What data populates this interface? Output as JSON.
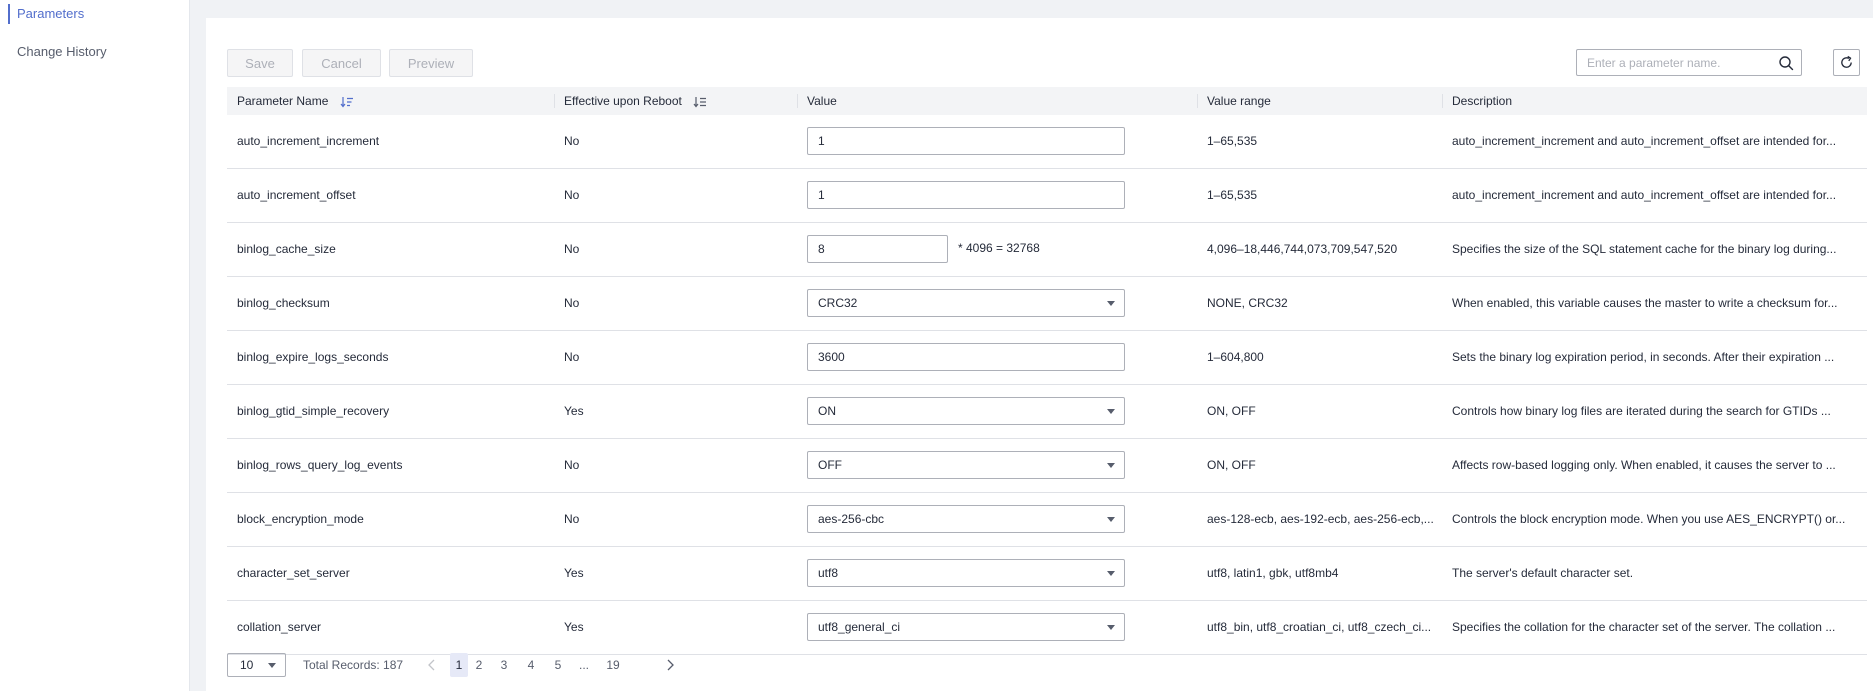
{
  "sidebar": {
    "items": [
      {
        "label": "Parameters",
        "active": true
      },
      {
        "label": "Change History",
        "active": false
      }
    ]
  },
  "toolbar": {
    "save_label": "Save",
    "cancel_label": "Cancel",
    "preview_label": "Preview",
    "search_placeholder": "Enter a parameter name.",
    "search_icon": "search-icon",
    "refresh_icon": "refresh-icon"
  },
  "table": {
    "columns": {
      "name": "Parameter Name",
      "reboot": "Effective upon Reboot",
      "value": "Value",
      "range": "Value range",
      "description": "Description"
    },
    "rows": [
      {
        "name": "auto_increment_increment",
        "reboot": "No",
        "value": "1",
        "control": "input",
        "range": "1–65,535",
        "description": "auto_increment_increment and auto_increment_offset are intended for..."
      },
      {
        "name": "auto_increment_offset",
        "reboot": "No",
        "value": "1",
        "control": "input",
        "range": "1–65,535",
        "description": "auto_increment_increment and auto_increment_offset are intended for..."
      },
      {
        "name": "binlog_cache_size",
        "reboot": "No",
        "value": "8",
        "control": "multiplier",
        "formula": "* 4096 = 32768",
        "range": "4,096–18,446,744,073,709,547,520",
        "description": "Specifies the size of the SQL statement cache for the binary log during..."
      },
      {
        "name": "binlog_checksum",
        "reboot": "No",
        "value": "CRC32",
        "control": "select",
        "range": "NONE, CRC32",
        "description": "When enabled, this variable causes the master to write a checksum for..."
      },
      {
        "name": "binlog_expire_logs_seconds",
        "reboot": "No",
        "value": "3600",
        "control": "input",
        "range": "1–604,800",
        "description": "Sets the binary log expiration period, in seconds. After their expiration ..."
      },
      {
        "name": "binlog_gtid_simple_recovery",
        "reboot": "Yes",
        "value": "ON",
        "control": "select",
        "range": "ON, OFF",
        "description": "Controls how binary log files are iterated during the search for GTIDs ..."
      },
      {
        "name": "binlog_rows_query_log_events",
        "reboot": "No",
        "value": "OFF",
        "control": "select",
        "range": "ON, OFF",
        "description": "Affects row-based logging only. When enabled, it causes the server to ..."
      },
      {
        "name": "block_encryption_mode",
        "reboot": "No",
        "value": "aes-256-cbc",
        "control": "select",
        "range": "aes-128-ecb, aes-192-ecb, aes-256-ecb,...",
        "description": "Controls the block encryption mode. When you use AES_ENCRYPT() or..."
      },
      {
        "name": "character_set_server",
        "reboot": "Yes",
        "value": "utf8",
        "control": "select",
        "range": "utf8, latin1, gbk, utf8mb4",
        "description": "The server's default character set."
      },
      {
        "name": "collation_server",
        "reboot": "Yes",
        "value": "utf8_general_ci",
        "control": "select",
        "range": "utf8_bin, utf8_croatian_ci, utf8_czech_ci...",
        "description": "Specifies the collation for the character set of the server. The collation ..."
      }
    ]
  },
  "pagination": {
    "page_size": "10",
    "total": "Total Records: 187",
    "pages": [
      "1",
      "2",
      "3",
      "4",
      "5",
      "...",
      "19"
    ],
    "current": "1",
    "prev_icon": "chevron-left-icon",
    "next_icon": "chevron-right-icon"
  },
  "colors": {
    "accent": "#526ecc",
    "border": "#dfe1e6",
    "header_bg": "#f3f4f6",
    "page_bg": "#f0f2f5"
  }
}
